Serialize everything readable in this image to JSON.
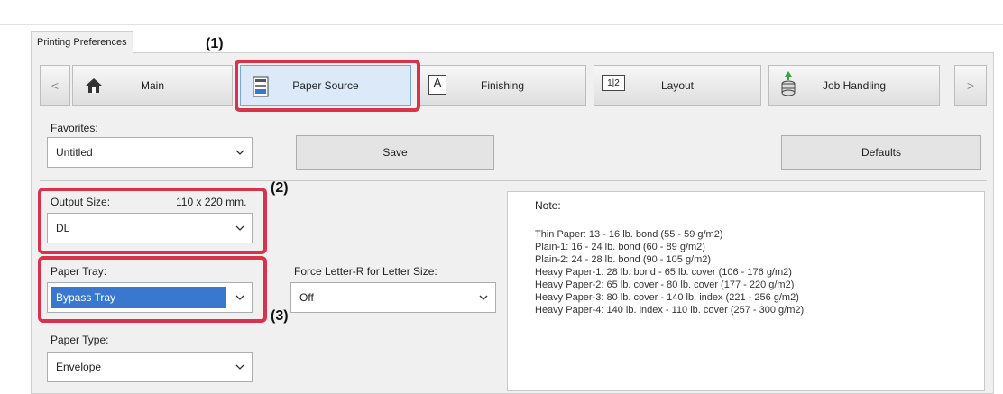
{
  "window_tab": "Printing Preferences",
  "nav": {
    "prev_arrow": "<",
    "next_arrow": ">",
    "tabs": [
      {
        "label": "Main",
        "icon": "home-icon"
      },
      {
        "label": "Paper Source",
        "icon": "paper-tray-icon",
        "active": true
      },
      {
        "label": "Finishing",
        "icon": "finishing-icon"
      },
      {
        "label": "Layout",
        "icon": "layout-icon"
      },
      {
        "label": "Job Handling",
        "icon": "job-handling-icon"
      }
    ],
    "layout_icon_text": "1|2",
    "finishing_icon_text": "A"
  },
  "callouts": {
    "c1": "(1)",
    "c2": "(2)",
    "c3": "(3)"
  },
  "favorites": {
    "label": "Favorites:",
    "value": "Untitled",
    "save_label": "Save",
    "defaults_label": "Defaults"
  },
  "output_size": {
    "label": "Output Size:",
    "dimension": "110 x 220 mm.",
    "value": "DL"
  },
  "paper_tray": {
    "label": "Paper Tray:",
    "value": "Bypass Tray"
  },
  "force_letter": {
    "label": "Force Letter-R for Letter Size:",
    "value": "Off"
  },
  "paper_type": {
    "label": "Paper Type:",
    "value": "Envelope"
  },
  "note": {
    "title": "Note:",
    "lines": [
      "Thin Paper: 13 - 16 lb. bond (55 - 59 g/m2)",
      "Plain-1: 16 - 24 lb. bond (60 - 89 g/m2)",
      "Plain-2: 24 - 28 lb. bond (90 - 105 g/m2)",
      "Heavy Paper-1: 28 lb. bond - 65 lb. cover (106 - 176 g/m2)",
      "Heavy Paper-2: 65 lb. cover - 80 lb. cover (177 - 220 g/m2)",
      "Heavy Paper-3: 80 lb. cover - 140 lb. index (221 - 256 g/m2)",
      "Heavy Paper-4: 140 lb. index - 110 lb. cover (257 - 300 g/m2)"
    ]
  },
  "colors": {
    "highlight": "#d8334a",
    "selection": "#3a78cf"
  }
}
